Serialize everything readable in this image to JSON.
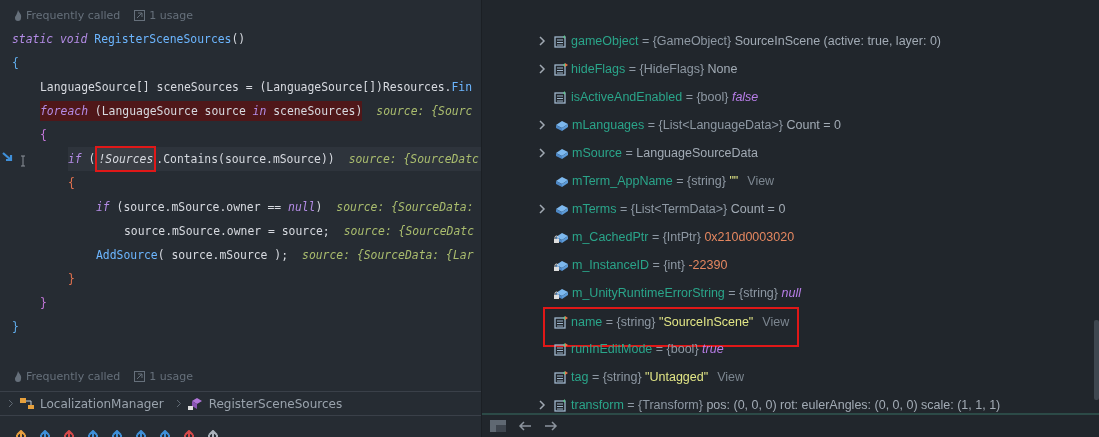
{
  "editor": {
    "codevision_top": {
      "called": "Frequently called",
      "usages": "1 usage"
    },
    "lines": [
      {
        "breakpoint": false,
        "current": false,
        "tokens": [
          {
            "kind": "keyword",
            "text": "static void "
          },
          {
            "kind": "method",
            "text": "RegisterSceneSources"
          },
          {
            "kind": "plain",
            "text": "()"
          }
        ]
      },
      {
        "breakpoint": false,
        "current": false,
        "tokens": [
          {
            "kind": "brace",
            "text": "{"
          }
        ],
        "children": [
          {
            "breakpoint": false,
            "current": false,
            "tokens": [
              {
                "kind": "plain",
                "text": "LanguageSource[] sceneSources = (LanguageSource[])Resources."
              },
              {
                "kind": "method",
                "text": "Fin"
              }
            ]
          },
          {
            "breakpoint": true,
            "current": false,
            "tokens": [
              {
                "kind": "keyword",
                "text": "foreach"
              },
              {
                "kind": "plain",
                "text": " (LanguageSource source "
              },
              {
                "kind": "keyword",
                "text": "in"
              },
              {
                "kind": "plain",
                "text": " sceneSources)"
              }
            ],
            "hint": "source: {Sourc"
          },
          {
            "breakpoint": false,
            "current": false,
            "tokens": [
              {
                "kind": "brace",
                "text": "{"
              }
            ],
            "children": [
              {
                "breakpoint": false,
                "current": true,
                "tokens": [
                  {
                    "kind": "keyword",
                    "text": "if"
                  },
                  {
                    "kind": "plain",
                    "text": " ("
                  },
                  {
                    "kind": "boxed",
                    "text": "!Sources"
                  },
                  {
                    "kind": "plain",
                    "text": ".Contains(source.mSource))"
                  }
                ],
                "hint": "source: {SourceDatc"
              },
              {
                "breakpoint": false,
                "current": false,
                "tokens": [
                  {
                    "kind": "brace",
                    "text": "{"
                  }
                ],
                "children": [
                  {
                    "breakpoint": false,
                    "current": false,
                    "tokens": [
                      {
                        "kind": "keyword",
                        "text": "if"
                      },
                      {
                        "kind": "plain",
                        "text": " (source.mSource.owner == "
                      },
                      {
                        "kind": "keyword",
                        "text": "null"
                      },
                      {
                        "kind": "plain",
                        "text": ")"
                      }
                    ],
                    "hint": "source: {SourceData:",
                    "children": [
                      {
                        "breakpoint": false,
                        "current": false,
                        "tokens": [
                          {
                            "kind": "plain",
                            "text": "source.mSource.owner = source;"
                          }
                        ],
                        "hint": "source: {SourceDatc"
                      }
                    ]
                  },
                  {
                    "breakpoint": false,
                    "current": false,
                    "tokens": [
                      {
                        "kind": "method",
                        "text": "AddSource"
                      },
                      {
                        "kind": "plain",
                        "text": "( source.mSource );"
                      }
                    ],
                    "hint": "source: {SourceData: {Lar"
                  }
                ]
              },
              {
                "breakpoint": false,
                "current": false,
                "tokens": [
                  {
                    "kind": "brace",
                    "text": "}"
                  }
                ]
              }
            ]
          },
          {
            "breakpoint": false,
            "current": false,
            "tokens": [
              {
                "kind": "brace",
                "text": "}"
              }
            ]
          }
        ]
      },
      {
        "breakpoint": false,
        "current": false,
        "tokens": [
          {
            "kind": "brace",
            "text": "}"
          }
        ]
      }
    ],
    "codevision_bottom": {
      "called": "Frequently called",
      "usages": "1 usage"
    }
  },
  "breadcrumb": [
    {
      "kind": "class",
      "label": "LocalizationManager"
    },
    {
      "kind": "method",
      "label": "RegisterSceneSources"
    }
  ],
  "variables": [
    {
      "expandable": true,
      "kind": "property",
      "name": "gameObject",
      "type": "= {GameObject}",
      "value": {
        "kind": "plain",
        "text": "SourceInScene (active: true, layer: 0)"
      },
      "boxed": false
    },
    {
      "expandable": true,
      "kind": "settable_property",
      "name": "hideFlags",
      "type": "= {HideFlags}",
      "value": {
        "kind": "plain",
        "text": "None"
      },
      "boxed": false
    },
    {
      "expandable": false,
      "kind": "property",
      "name": "isActiveAndEnabled",
      "type": "= {bool}",
      "value": {
        "kind": "keyword",
        "text": "false"
      },
      "boxed": false
    },
    {
      "expandable": true,
      "kind": "field",
      "name": "mLanguages",
      "type": "= {List<LanguageData>}",
      "value": {
        "kind": "plain",
        "text": "Count = 0"
      },
      "boxed": false
    },
    {
      "expandable": true,
      "kind": "field",
      "name": "mSource",
      "type": "=",
      "value": {
        "kind": "plain",
        "text": "LanguageSourceData"
      },
      "boxed": false
    },
    {
      "expandable": false,
      "kind": "field",
      "name": "mTerm_AppName",
      "type": "= {string}",
      "value": {
        "kind": "string",
        "text": "\"\""
      },
      "link": "View",
      "boxed": false
    },
    {
      "expandable": true,
      "kind": "field",
      "name": "mTerms",
      "type": "= {List<TermData>}",
      "value": {
        "kind": "plain",
        "text": "Count = 0"
      },
      "boxed": false
    },
    {
      "expandable": false,
      "kind": "private_field",
      "name": "m_CachedPtr",
      "type": "= {IntPtr}",
      "value": {
        "kind": "number",
        "text": "0x210d0003020"
      },
      "boxed": false
    },
    {
      "expandable": false,
      "kind": "private_field",
      "name": "m_InstanceID",
      "type": "= {int}",
      "value": {
        "kind": "number",
        "text": "-22390"
      },
      "boxed": false
    },
    {
      "expandable": false,
      "kind": "private_field",
      "name": "m_UnityRuntimeErrorString",
      "type": "= {string}",
      "value": {
        "kind": "keyword",
        "text": "null"
      },
      "boxed": false
    },
    {
      "expandable": false,
      "kind": "settable_property",
      "name": "name",
      "type": "= {string}",
      "value": {
        "kind": "string",
        "text": "\"SourceInScene\""
      },
      "link": "View",
      "boxed": true
    },
    {
      "expandable": false,
      "kind": "settable_property",
      "name": "runInEditMode",
      "type": "= {bool}",
      "value": {
        "kind": "keyword",
        "text": "true"
      },
      "boxed": false
    },
    {
      "expandable": false,
      "kind": "settable_property",
      "name": "tag",
      "type": "= {string}",
      "value": {
        "kind": "string",
        "text": "\"Untagged\""
      },
      "link": "View",
      "boxed": false
    },
    {
      "expandable": true,
      "kind": "property",
      "name": "transform",
      "type": "= {Transform}",
      "value": {
        "kind": "plain",
        "text": "pos: (0, 0, 0) rot: eulerAngles: (0, 0, 0) scale: (1, 1, 1)"
      },
      "boxed": false
    }
  ]
}
